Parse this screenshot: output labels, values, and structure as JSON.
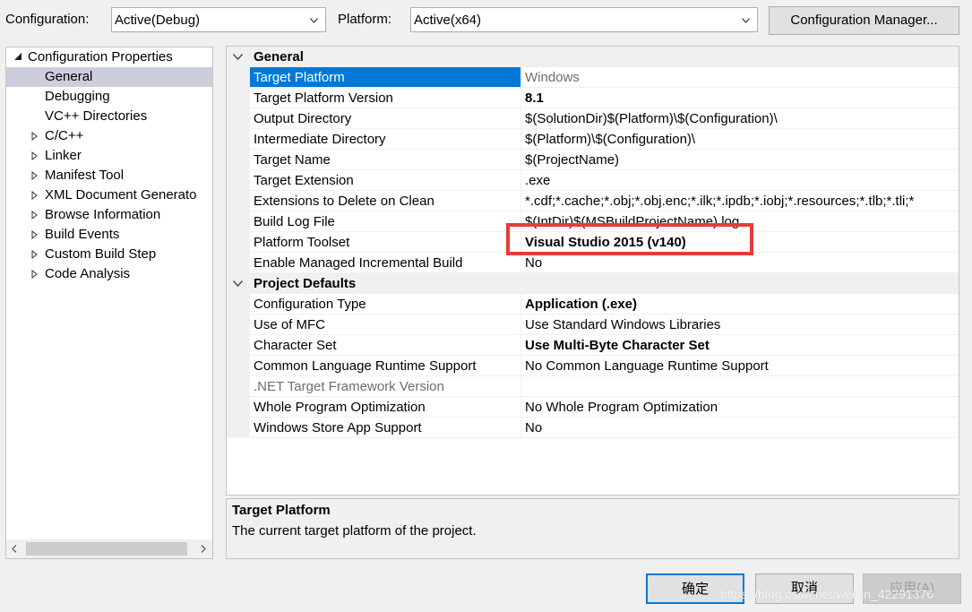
{
  "header": {
    "configuration_label": "Configuration:",
    "configuration_value": "Active(Debug)",
    "platform_label": "Platform:",
    "platform_value": "Active(x64)",
    "config_manager_button": "Configuration Manager..."
  },
  "tree": {
    "root": "Configuration Properties",
    "items": [
      {
        "label": "General",
        "selected": true,
        "expandable": false
      },
      {
        "label": "Debugging",
        "selected": false,
        "expandable": false
      },
      {
        "label": "VC++ Directories",
        "selected": false,
        "expandable": false
      },
      {
        "label": "C/C++",
        "selected": false,
        "expandable": true
      },
      {
        "label": "Linker",
        "selected": false,
        "expandable": true
      },
      {
        "label": "Manifest Tool",
        "selected": false,
        "expandable": true
      },
      {
        "label": "XML Document Generato",
        "selected": false,
        "expandable": true
      },
      {
        "label": "Browse Information",
        "selected": false,
        "expandable": true
      },
      {
        "label": "Build Events",
        "selected": false,
        "expandable": true
      },
      {
        "label": "Custom Build Step",
        "selected": false,
        "expandable": true
      },
      {
        "label": "Code Analysis",
        "selected": false,
        "expandable": true
      }
    ]
  },
  "grid": {
    "sections": [
      {
        "title": "General",
        "rows": [
          {
            "name": "Target Platform",
            "value": "Windows",
            "selected": true,
            "value_style": "gray"
          },
          {
            "name": "Target Platform Version",
            "value": "8.1",
            "value_style": "bold"
          },
          {
            "name": "Output Directory",
            "value": "$(SolutionDir)$(Platform)\\$(Configuration)\\"
          },
          {
            "name": "Intermediate Directory",
            "value": "$(Platform)\\$(Configuration)\\"
          },
          {
            "name": "Target Name",
            "value": "$(ProjectName)"
          },
          {
            "name": "Target Extension",
            "value": ".exe"
          },
          {
            "name": "Extensions to Delete on Clean",
            "value": "*.cdf;*.cache;*.obj;*.obj.enc;*.ilk;*.ipdb;*.iobj;*.resources;*.tlb;*.tli;*"
          },
          {
            "name": "Build Log File",
            "value": "$(IntDir)$(MSBuildProjectName).log"
          },
          {
            "name": "Platform Toolset",
            "value": "Visual Studio 2015 (v140)",
            "value_style": "bold"
          },
          {
            "name": "Enable Managed Incremental Build",
            "value": "No"
          }
        ]
      },
      {
        "title": "Project Defaults",
        "rows": [
          {
            "name": "Configuration Type",
            "value": "Application (.exe)",
            "value_style": "bold"
          },
          {
            "name": "Use of MFC",
            "value": "Use Standard Windows Libraries"
          },
          {
            "name": "Character Set",
            "value": "Use Multi-Byte Character Set",
            "value_style": "bold"
          },
          {
            "name": "Common Language Runtime Support",
            "value": "No Common Language Runtime Support"
          },
          {
            "name": ".NET Target Framework Version",
            "value": "",
            "name_style": "gray"
          },
          {
            "name": "Whole Program Optimization",
            "value": "No Whole Program Optimization"
          },
          {
            "name": "Windows Store App Support",
            "value": "No"
          }
        ]
      }
    ]
  },
  "description": {
    "title": "Target Platform",
    "text": "The current target platform of the project."
  },
  "buttons": {
    "ok": "确定",
    "cancel": "取消",
    "apply": "应用(A)"
  },
  "watermark": "https://blog.csdn.net/weixin_42291376",
  "colors": {
    "selection": "#0078d7",
    "tree_selection": "#cccedb",
    "highlight_box": "#e83a3a"
  }
}
